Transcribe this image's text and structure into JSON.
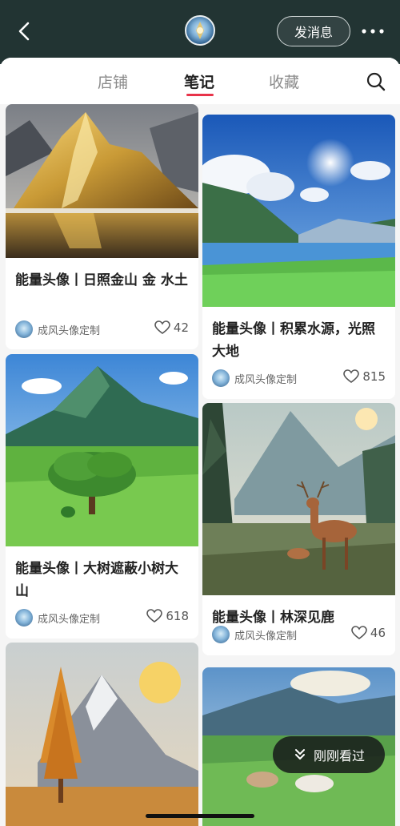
{
  "header": {
    "message_label": "发消息"
  },
  "tabs": [
    {
      "label": "店铺"
    },
    {
      "label": "笔记"
    },
    {
      "label": "收藏"
    }
  ],
  "notes": [
    {
      "title": "能量头像丨日照金山 金 水土",
      "author": "成风头像定制",
      "likes": "42"
    },
    {
      "title": "能量头像丨积累水源，光照大地",
      "author": "成风头像定制",
      "likes": "815"
    },
    {
      "title": "能量头像丨大树遮蔽小树大山",
      "author": "成风头像定制",
      "likes": "618"
    },
    {
      "title": "能量头像丨林深见鹿",
      "author": "成风头像定制",
      "likes": "46"
    }
  ],
  "recent_button": {
    "label": "刚刚看过"
  }
}
